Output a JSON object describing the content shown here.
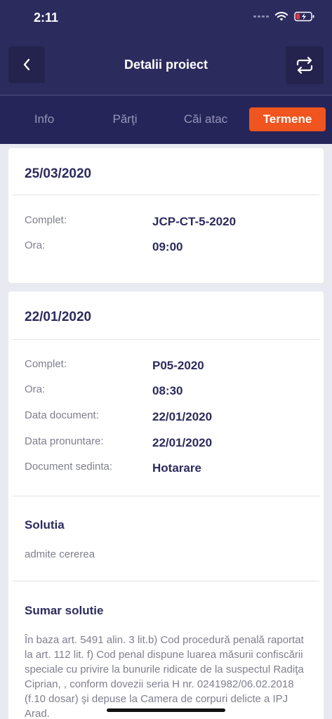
{
  "status": {
    "time": "2:11"
  },
  "nav": {
    "title": "Detalii proiect"
  },
  "tabs": [
    {
      "label": "Info"
    },
    {
      "label": "Părţi"
    },
    {
      "label": "Căi atac"
    },
    {
      "label": "Termene"
    }
  ],
  "colors": {
    "header": "#2c2b5e",
    "tabbar": "#26255a",
    "accent": "#f0541f",
    "page_bg": "#e9e9f1"
  },
  "cards": [
    {
      "date": "25/03/2020",
      "rows": [
        {
          "label": "Complet:",
          "value": "JCP-CT-5-2020"
        },
        {
          "label": "Ora:",
          "value": "09:00"
        }
      ]
    },
    {
      "date": "22/01/2020",
      "rows": [
        {
          "label": "Complet:",
          "value": "P05-2020"
        },
        {
          "label": "Ora:",
          "value": "08:30"
        },
        {
          "label": "Data document:",
          "value": "22/01/2020"
        },
        {
          "label": "Data pronuntare:",
          "value": "22/01/2020"
        },
        {
          "label": "Document sedinta:",
          "value": "Hotarare"
        }
      ],
      "solutia": {
        "title": "Solutia",
        "text": "admite cererea"
      },
      "sumar": {
        "title": "Sumar solutie",
        "text": "În baza art. 5491 alin. 3 lit.b) Cod procedură penală raportat la art. 112 lit. f) Cod penal dispune luarea măsurii confiscării speciale cu privire la bunurile ridicate de la suspectul Radiţa Ciprian, , conform dovezii seria H nr. 0241982/06.02.2018 (f.10 dosar) şi depuse la Camera de corpuri delicte a IPJ Arad."
      }
    }
  ]
}
